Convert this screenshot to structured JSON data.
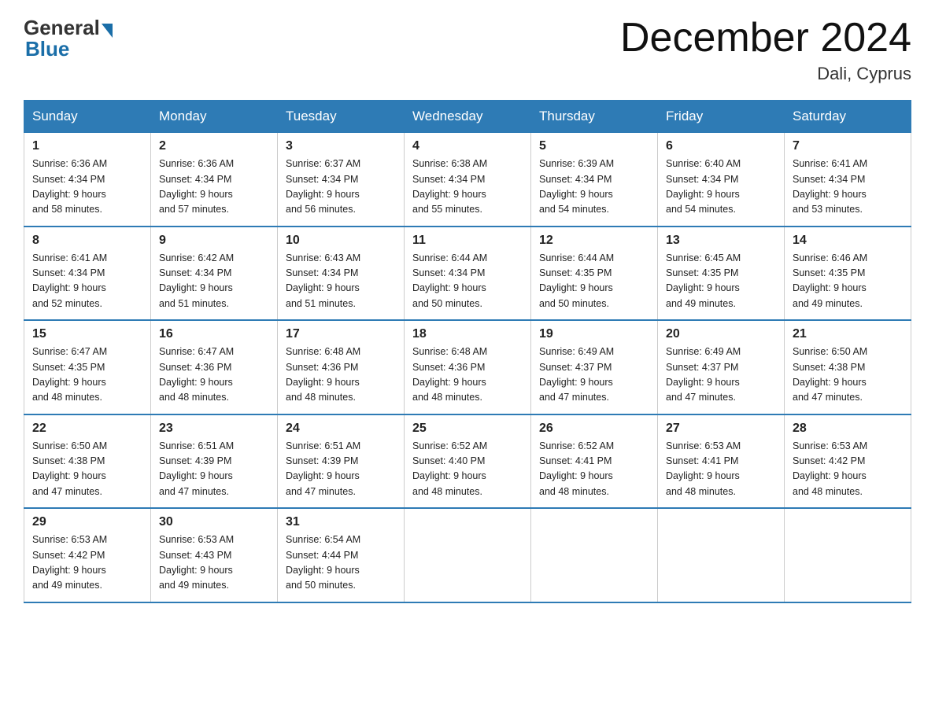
{
  "header": {
    "logo_general": "General",
    "logo_blue": "Blue",
    "month_title": "December 2024",
    "location": "Dali, Cyprus"
  },
  "days_of_week": [
    "Sunday",
    "Monday",
    "Tuesday",
    "Wednesday",
    "Thursday",
    "Friday",
    "Saturday"
  ],
  "weeks": [
    [
      {
        "day": "1",
        "sunrise": "6:36 AM",
        "sunset": "4:34 PM",
        "daylight": "9 hours and 58 minutes."
      },
      {
        "day": "2",
        "sunrise": "6:36 AM",
        "sunset": "4:34 PM",
        "daylight": "9 hours and 57 minutes."
      },
      {
        "day": "3",
        "sunrise": "6:37 AM",
        "sunset": "4:34 PM",
        "daylight": "9 hours and 56 minutes."
      },
      {
        "day": "4",
        "sunrise": "6:38 AM",
        "sunset": "4:34 PM",
        "daylight": "9 hours and 55 minutes."
      },
      {
        "day": "5",
        "sunrise": "6:39 AM",
        "sunset": "4:34 PM",
        "daylight": "9 hours and 54 minutes."
      },
      {
        "day": "6",
        "sunrise": "6:40 AM",
        "sunset": "4:34 PM",
        "daylight": "9 hours and 54 minutes."
      },
      {
        "day": "7",
        "sunrise": "6:41 AM",
        "sunset": "4:34 PM",
        "daylight": "9 hours and 53 minutes."
      }
    ],
    [
      {
        "day": "8",
        "sunrise": "6:41 AM",
        "sunset": "4:34 PM",
        "daylight": "9 hours and 52 minutes."
      },
      {
        "day": "9",
        "sunrise": "6:42 AM",
        "sunset": "4:34 PM",
        "daylight": "9 hours and 51 minutes."
      },
      {
        "day": "10",
        "sunrise": "6:43 AM",
        "sunset": "4:34 PM",
        "daylight": "9 hours and 51 minutes."
      },
      {
        "day": "11",
        "sunrise": "6:44 AM",
        "sunset": "4:34 PM",
        "daylight": "9 hours and 50 minutes."
      },
      {
        "day": "12",
        "sunrise": "6:44 AM",
        "sunset": "4:35 PM",
        "daylight": "9 hours and 50 minutes."
      },
      {
        "day": "13",
        "sunrise": "6:45 AM",
        "sunset": "4:35 PM",
        "daylight": "9 hours and 49 minutes."
      },
      {
        "day": "14",
        "sunrise": "6:46 AM",
        "sunset": "4:35 PM",
        "daylight": "9 hours and 49 minutes."
      }
    ],
    [
      {
        "day": "15",
        "sunrise": "6:47 AM",
        "sunset": "4:35 PM",
        "daylight": "9 hours and 48 minutes."
      },
      {
        "day": "16",
        "sunrise": "6:47 AM",
        "sunset": "4:36 PM",
        "daylight": "9 hours and 48 minutes."
      },
      {
        "day": "17",
        "sunrise": "6:48 AM",
        "sunset": "4:36 PM",
        "daylight": "9 hours and 48 minutes."
      },
      {
        "day": "18",
        "sunrise": "6:48 AM",
        "sunset": "4:36 PM",
        "daylight": "9 hours and 48 minutes."
      },
      {
        "day": "19",
        "sunrise": "6:49 AM",
        "sunset": "4:37 PM",
        "daylight": "9 hours and 47 minutes."
      },
      {
        "day": "20",
        "sunrise": "6:49 AM",
        "sunset": "4:37 PM",
        "daylight": "9 hours and 47 minutes."
      },
      {
        "day": "21",
        "sunrise": "6:50 AM",
        "sunset": "4:38 PM",
        "daylight": "9 hours and 47 minutes."
      }
    ],
    [
      {
        "day": "22",
        "sunrise": "6:50 AM",
        "sunset": "4:38 PM",
        "daylight": "9 hours and 47 minutes."
      },
      {
        "day": "23",
        "sunrise": "6:51 AM",
        "sunset": "4:39 PM",
        "daylight": "9 hours and 47 minutes."
      },
      {
        "day": "24",
        "sunrise": "6:51 AM",
        "sunset": "4:39 PM",
        "daylight": "9 hours and 47 minutes."
      },
      {
        "day": "25",
        "sunrise": "6:52 AM",
        "sunset": "4:40 PM",
        "daylight": "9 hours and 48 minutes."
      },
      {
        "day": "26",
        "sunrise": "6:52 AM",
        "sunset": "4:41 PM",
        "daylight": "9 hours and 48 minutes."
      },
      {
        "day": "27",
        "sunrise": "6:53 AM",
        "sunset": "4:41 PM",
        "daylight": "9 hours and 48 minutes."
      },
      {
        "day": "28",
        "sunrise": "6:53 AM",
        "sunset": "4:42 PM",
        "daylight": "9 hours and 48 minutes."
      }
    ],
    [
      {
        "day": "29",
        "sunrise": "6:53 AM",
        "sunset": "4:42 PM",
        "daylight": "9 hours and 49 minutes."
      },
      {
        "day": "30",
        "sunrise": "6:53 AM",
        "sunset": "4:43 PM",
        "daylight": "9 hours and 49 minutes."
      },
      {
        "day": "31",
        "sunrise": "6:54 AM",
        "sunset": "4:44 PM",
        "daylight": "9 hours and 50 minutes."
      },
      null,
      null,
      null,
      null
    ]
  ],
  "labels": {
    "sunrise": "Sunrise:",
    "sunset": "Sunset:",
    "daylight": "Daylight:"
  }
}
